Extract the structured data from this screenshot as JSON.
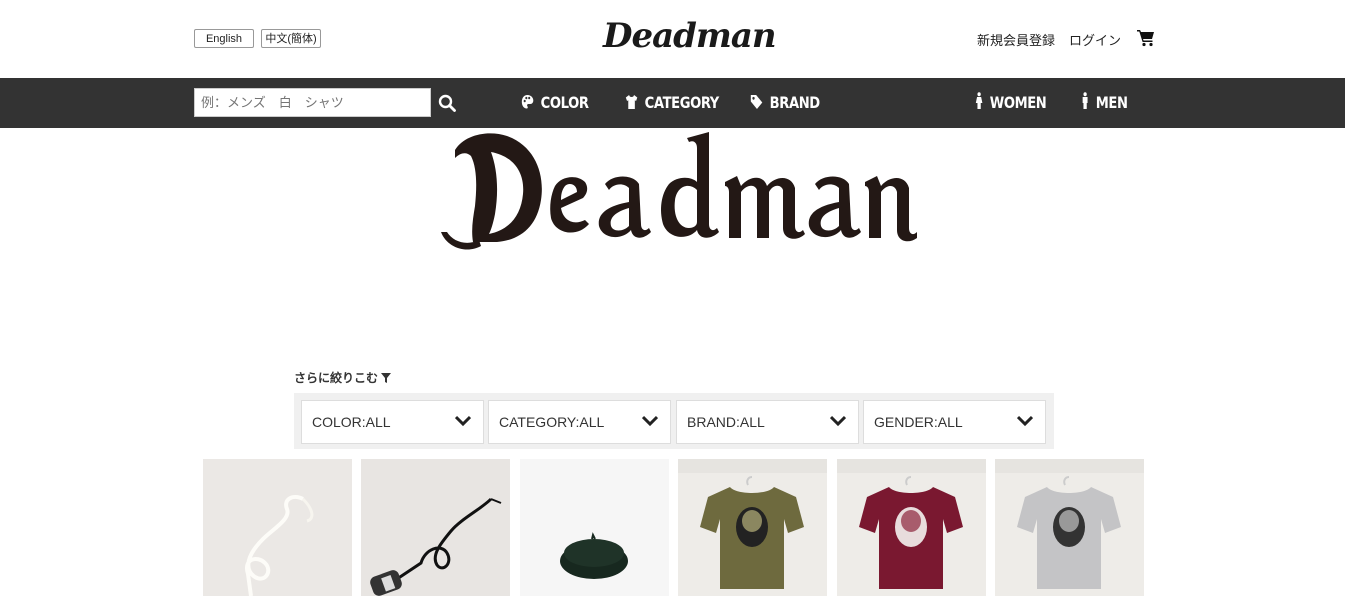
{
  "header": {
    "lang_en": "English",
    "lang_zh": "中文(簡体)",
    "logo": "Deadman",
    "register": "新規会員登録",
    "login": "ログイン",
    "cart_icon": "cart-icon"
  },
  "nav": {
    "search_placeholder": "例：メンズ　白　シャツ",
    "items": [
      {
        "label": "COLOR",
        "icon": "palette-icon"
      },
      {
        "label": "CATEGORY",
        "icon": "tshirt-icon"
      },
      {
        "label": "BRAND",
        "icon": "tag-icon"
      },
      {
        "label": "WOMEN",
        "icon": "female-icon"
      },
      {
        "label": "MEN",
        "icon": "male-icon"
      }
    ],
    "bg_color": "#333333"
  },
  "hero": {
    "logo": "Deadman"
  },
  "filters": {
    "title": "さらに絞りこむ",
    "selects": [
      {
        "value": "COLOR:ALL"
      },
      {
        "value": "CATEGORY:ALL"
      },
      {
        "value": "BRAND:ALL"
      },
      {
        "value": "GENDER:ALL"
      }
    ]
  },
  "products": [
    {
      "name": "white-cord-necklace"
    },
    {
      "name": "black-cord-necklace"
    },
    {
      "name": "green-beret"
    },
    {
      "name": "olive-tshirt"
    },
    {
      "name": "burgundy-tshirt"
    },
    {
      "name": "grey-tshirt"
    }
  ]
}
